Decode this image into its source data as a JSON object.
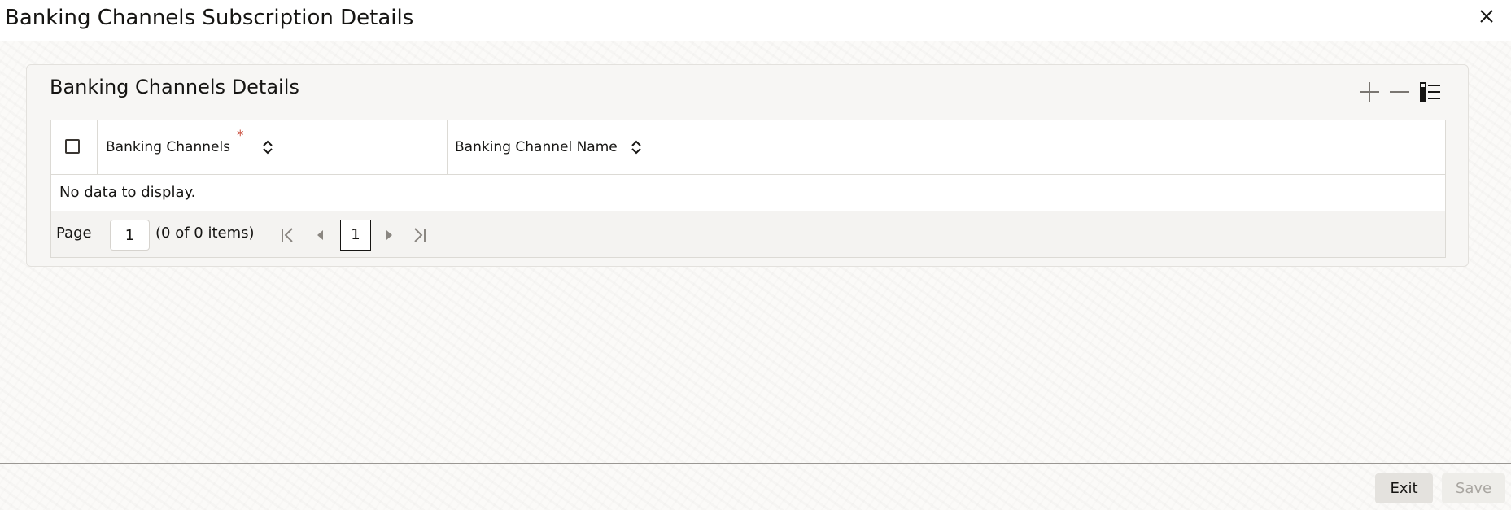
{
  "window": {
    "title": "Banking Channels Subscription Details"
  },
  "panel": {
    "title": "Banking Channels Details",
    "toolbar": {
      "add_icon": "plus-icon",
      "remove_icon": "minus-icon",
      "columns_icon": "list-icon"
    }
  },
  "table": {
    "columns": [
      {
        "label": "Banking Channels",
        "required": true,
        "sortable": true
      },
      {
        "label": "Banking Channel Name",
        "required": false,
        "sortable": true
      }
    ],
    "required_marker": "*",
    "empty_message": "No data to display.",
    "rows": []
  },
  "pagination": {
    "page_label": "Page",
    "page_input_value": "1",
    "items_summary": "(0 of 0 items)",
    "current_page": "1"
  },
  "footer": {
    "exit_label": "Exit",
    "save_label": "Save"
  },
  "colors": {
    "required": "#c74634",
    "text": "#161513",
    "disabled_text": "#a9a6a1"
  }
}
